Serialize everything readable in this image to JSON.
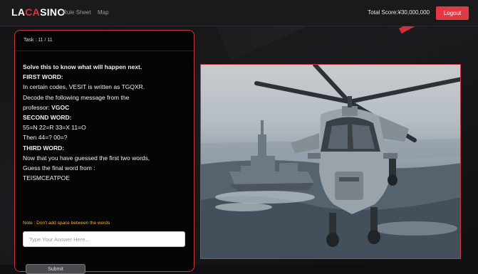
{
  "navbar": {
    "brand_prefix": "LA",
    "brand_mid": "CA",
    "brand_suffix": "SINO",
    "links": [
      "Rule Sheet",
      "Map"
    ],
    "total_score": "Total Score:¥30,000,000",
    "logout_label": "Logout"
  },
  "task": {
    "counter": "Task : 11 / 11",
    "lines": [
      "Solve this to know what will happen next.",
      "FIRST WORD:",
      "In certain codes, VESIT is written as TGQXR.",
      "Decode the following message from the",
      "SECOND WORD:",
      "55=N 22=R 33=X 11=O",
      "Then 44=? 00=?",
      "THIRD WORD:",
      "Now that you have guessed the first two words,",
      "Guess the final word from :",
      "TEISMCEATPOE"
    ],
    "professor_label": "professor:",
    "professor_code": "VGOC",
    "note": "Note : Don't add space between the words",
    "answer_placeholder": "Type Your Answer Here...",
    "submit_label": "Submit"
  },
  "image": {
    "subject": "military-helicopter-over-sea-with-warship"
  },
  "colors": {
    "accent": "#e23744",
    "panel_border": "#c7353f",
    "note": "#e8b84a"
  }
}
